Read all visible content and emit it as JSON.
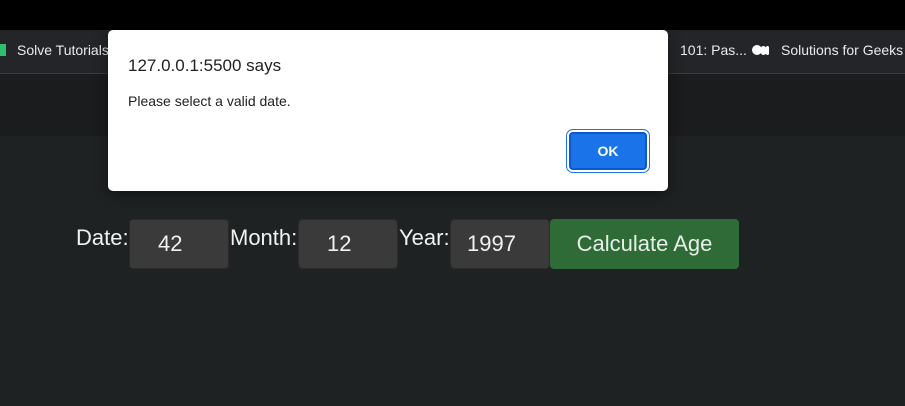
{
  "browser": {
    "bookmarks": [
      {
        "label": "Solve Tutorials"
      },
      {
        "label": "101: Pas..."
      },
      {
        "label": "Solutions for Geeks"
      }
    ]
  },
  "form": {
    "date_label": "Date:",
    "date_value": "42",
    "month_label": "Month:",
    "month_value": "12",
    "year_label": "Year:",
    "year_value": "1997",
    "calculate_button": "Calculate Age"
  },
  "alert": {
    "origin": "127.0.0.1:5500 says",
    "message": "Please select a valid date.",
    "ok_label": "OK"
  },
  "colors": {
    "button_green": "#2f6b37",
    "ok_blue": "#1a73e8",
    "page_bg": "#1f2223"
  }
}
